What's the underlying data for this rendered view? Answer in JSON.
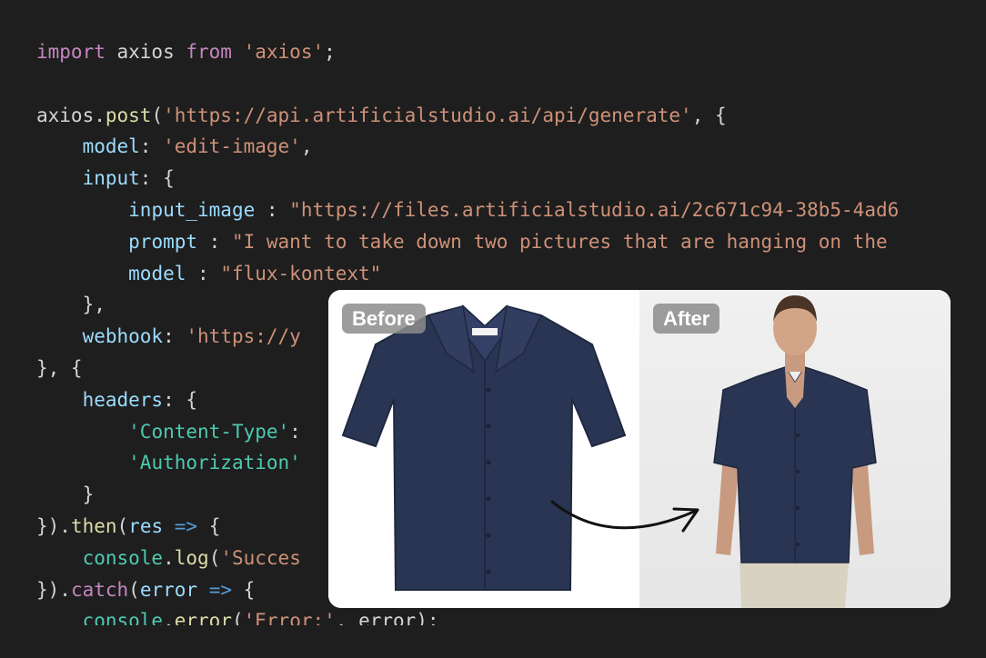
{
  "colors": {
    "background": "#1e1e1e",
    "default": "#d4d4d4",
    "keyword": "#c586c0",
    "string": "#ce9178",
    "property": "#9cdcfe",
    "function": "#dcdcaa",
    "type": "#4ec9b0",
    "arrow": "#569cd6"
  },
  "code": [
    [
      {
        "t": "import",
        "c": "keyword"
      },
      {
        "t": " axios ",
        "c": "default"
      },
      {
        "t": "from",
        "c": "keyword"
      },
      {
        "t": " ",
        "c": "default"
      },
      {
        "t": "'axios'",
        "c": "string"
      },
      {
        "t": ";",
        "c": "default"
      }
    ],
    [],
    [
      {
        "t": "axios.",
        "c": "default"
      },
      {
        "t": "post",
        "c": "function"
      },
      {
        "t": "(",
        "c": "default"
      },
      {
        "t": "'https://api.artificialstudio.ai/api/generate'",
        "c": "string"
      },
      {
        "t": ", {",
        "c": "default"
      }
    ],
    [
      {
        "t": "    ",
        "c": "default"
      },
      {
        "t": "model",
        "c": "property"
      },
      {
        "t": ": ",
        "c": "default"
      },
      {
        "t": "'edit-image'",
        "c": "string"
      },
      {
        "t": ",",
        "c": "default"
      }
    ],
    [
      {
        "t": "    ",
        "c": "default"
      },
      {
        "t": "input",
        "c": "property"
      },
      {
        "t": ": {",
        "c": "default"
      }
    ],
    [
      {
        "t": "        ",
        "c": "default"
      },
      {
        "t": "input_image",
        "c": "property"
      },
      {
        "t": " : ",
        "c": "default"
      },
      {
        "t": "\"https://files.artificialstudio.ai/2c671c94-38b5-4ad6",
        "c": "string"
      }
    ],
    [
      {
        "t": "        ",
        "c": "default"
      },
      {
        "t": "prompt",
        "c": "property"
      },
      {
        "t": " : ",
        "c": "default"
      },
      {
        "t": "\"I want to take down two pictures that are hanging on the",
        "c": "string"
      }
    ],
    [
      {
        "t": "        ",
        "c": "default"
      },
      {
        "t": "model",
        "c": "property"
      },
      {
        "t": " : ",
        "c": "default"
      },
      {
        "t": "\"flux-kontext\"",
        "c": "string"
      }
    ],
    [
      {
        "t": "    },",
        "c": "default"
      }
    ],
    [
      {
        "t": "    ",
        "c": "default"
      },
      {
        "t": "webhook",
        "c": "property"
      },
      {
        "t": ": ",
        "c": "default"
      },
      {
        "t": "'https://y",
        "c": "string"
      }
    ],
    [
      {
        "t": "}, {",
        "c": "default"
      }
    ],
    [
      {
        "t": "    ",
        "c": "default"
      },
      {
        "t": "headers",
        "c": "property"
      },
      {
        "t": ": {",
        "c": "default"
      }
    ],
    [
      {
        "t": "        ",
        "c": "default"
      },
      {
        "t": "'Content-Type'",
        "c": "type"
      },
      {
        "t": ":",
        "c": "default"
      }
    ],
    [
      {
        "t": "        ",
        "c": "default"
      },
      {
        "t": "'Authorization'",
        "c": "type"
      }
    ],
    [
      {
        "t": "    }",
        "c": "default"
      }
    ],
    [
      {
        "t": "}).",
        "c": "default"
      },
      {
        "t": "then",
        "c": "function"
      },
      {
        "t": "(",
        "c": "default"
      },
      {
        "t": "res",
        "c": "property"
      },
      {
        "t": " ",
        "c": "default"
      },
      {
        "t": "=>",
        "c": "arrow"
      },
      {
        "t": " {",
        "c": "default"
      }
    ],
    [
      {
        "t": "    ",
        "c": "default"
      },
      {
        "t": "console",
        "c": "type"
      },
      {
        "t": ".",
        "c": "default"
      },
      {
        "t": "log",
        "c": "function"
      },
      {
        "t": "(",
        "c": "default"
      },
      {
        "t": "'Succes",
        "c": "string"
      }
    ],
    [
      {
        "t": "}).",
        "c": "default"
      },
      {
        "t": "catch",
        "c": "keyword"
      },
      {
        "t": "(",
        "c": "default"
      },
      {
        "t": "error",
        "c": "property"
      },
      {
        "t": " ",
        "c": "default"
      },
      {
        "t": "=>",
        "c": "arrow"
      },
      {
        "t": " {",
        "c": "default"
      }
    ],
    [
      {
        "t": "    ",
        "c": "default"
      },
      {
        "t": "console",
        "c": "type"
      },
      {
        "t": ".",
        "c": "default"
      },
      {
        "t": "error",
        "c": "function"
      },
      {
        "t": "(",
        "c": "default"
      },
      {
        "t": "'Error:'",
        "c": "string"
      },
      {
        "t": ", error);",
        "c": "default"
      }
    ]
  ],
  "comparison": {
    "before_label": "Before",
    "after_label": "After",
    "shirt_color": "#2a3553"
  }
}
